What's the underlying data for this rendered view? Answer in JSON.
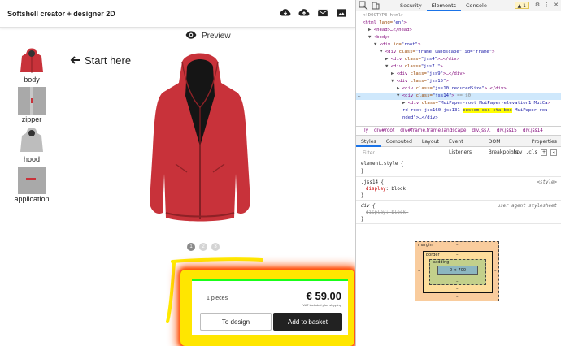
{
  "app": {
    "title": "Softshell creator + designer 2D",
    "toolbar_icons": [
      "download-icon",
      "upload-icon",
      "mail-icon",
      "gallery-icon"
    ],
    "preview_label": "Preview",
    "start_here": "Start here",
    "thumbs": [
      {
        "label": "body",
        "icon": "hoodie-body-icon"
      },
      {
        "label": "zipper",
        "icon": "zipper-icon"
      },
      {
        "label": "hood",
        "icon": "hood-icon"
      },
      {
        "label": "application",
        "icon": "application-icon"
      }
    ],
    "pager": [
      "1",
      "2",
      "3"
    ],
    "cta": {
      "pieces": "1 pieces",
      "price": "€ 59.00",
      "vat_note": "VAT included plus shipping",
      "design_button": "To design",
      "basket_button": "Add to basket"
    },
    "colors": {
      "jacket": "#c8323a",
      "highlight": "#ffe600",
      "glow": "#ff3300",
      "cta_border": "#19ff19"
    }
  },
  "devtools": {
    "tabs": [
      "Security",
      "Elements",
      "Console"
    ],
    "active_tab": "Elements",
    "warnings": "1",
    "dom_lines": [
      {
        "indent": 0,
        "html": "<!DOCTYPE html>",
        "kind": "comment"
      },
      {
        "indent": 0,
        "tag": "html",
        "attrs": " lang=\"en\"",
        "tri": ""
      },
      {
        "indent": 1,
        "tag": "head",
        "tail": "…</head>",
        "tri": "▶"
      },
      {
        "indent": 1,
        "tag": "body",
        "tri": "▼"
      },
      {
        "indent": 2,
        "tag": "div",
        "attrs": " id=\"root\"",
        "tri": "▼"
      },
      {
        "indent": 3,
        "tag": "div",
        "attrs": " class=\"frame landscape\" id=\"frame\"",
        "tri": "▼"
      },
      {
        "indent": 4,
        "tag": "div",
        "attrs": " class=\"jss4\"",
        "tail": "…</div>",
        "tri": "▶"
      },
      {
        "indent": 4,
        "tag": "div",
        "attrs": " class=\"jss7 \"",
        "tri": "▼"
      },
      {
        "indent": 5,
        "tag": "div",
        "attrs": " class=\"jss9\"",
        "tail": "…</div>",
        "tri": "▶"
      },
      {
        "indent": 5,
        "tag": "div",
        "attrs": " class=\"jss15\"",
        "tri": "▼"
      },
      {
        "indent": 6,
        "tag": "div",
        "attrs": " class=\"jss10  reducedSize\"",
        "tail": "…</div>",
        "tri": "▶"
      },
      {
        "indent": 6,
        "tag": "div",
        "attrs": " class=\"jss14\"",
        "tail": " == $0",
        "tri": "▼",
        "selected": true
      },
      {
        "indent": 7,
        "tag": "div",
        "attrs": " class=\"MuiPaper-root MuiPaper-elevation1 MuiCa",
        "tri": "▶"
      },
      {
        "indent": 7,
        "text": "rd-root jss160 jss131 ",
        "highlight": "custom-css-cta-box",
        "after": " MuiPaper-rou"
      },
      {
        "indent": 7,
        "text": "nded\">…</div>"
      }
    ],
    "breadcrumbs": [
      "ly",
      "div#root",
      "div#frame.frame.landscape",
      "div.jss7.",
      "div.jss15",
      "div.jss14"
    ],
    "sub_tabs": [
      "Styles",
      "Computed",
      "Layout",
      "Event Listeners",
      "DOM Breakpoints",
      "Properties"
    ],
    "active_sub_tab": "Styles",
    "filter_placeholder": "Filter",
    "filter_hov": ":hov",
    "filter_cls": ".cls",
    "rules": [
      {
        "selector": "element.style {",
        "close": "}",
        "props": [],
        "source": ""
      },
      {
        "selector": ".jss14 {",
        "close": "}",
        "props": [
          {
            "name": "display",
            "value": "block;",
            "struck": false
          }
        ],
        "source": "<style>"
      },
      {
        "selector": "div {",
        "close": "}",
        "props": [
          {
            "name": "display",
            "value": "block;",
            "struck": true
          }
        ],
        "source": "user agent stylesheet"
      }
    ],
    "box_model": {
      "margin_label": "margin",
      "border_label": "border",
      "padding_label": "padding",
      "content": "0 × 700",
      "dash": "–"
    }
  }
}
